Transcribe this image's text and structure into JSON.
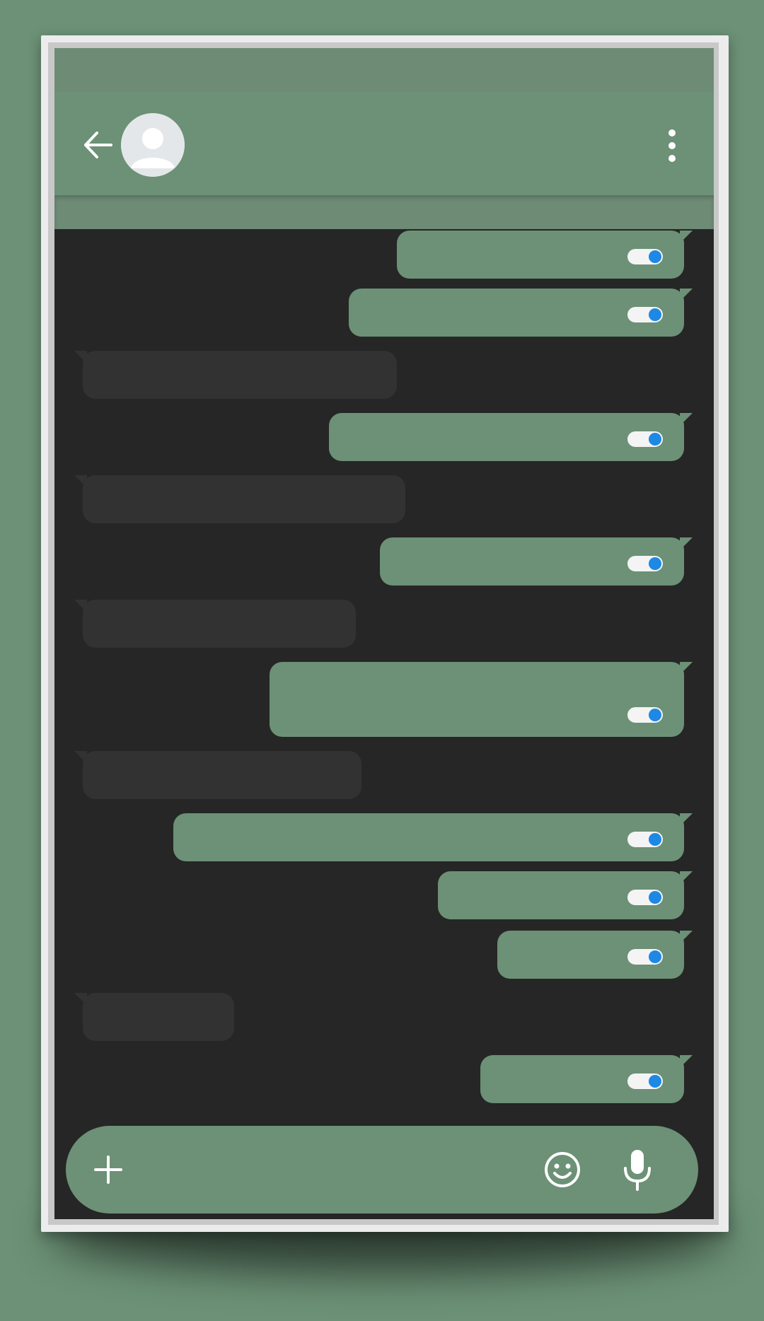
{
  "colors": {
    "accent": "#6c9176",
    "status_bar": "#6e8b76",
    "chat_bg": "#262626",
    "incoming_bubble": "#323232",
    "toggle_knob": "#1e88e5",
    "toggle_track": "#f4f4f4"
  },
  "header": {
    "back_icon": "arrow-left-icon",
    "avatar_icon": "person-avatar-icon",
    "menu_icon": "more-vertical-icon"
  },
  "messages": [
    {
      "direction": "out",
      "text": "",
      "read_toggle": "on"
    },
    {
      "direction": "out",
      "text": "",
      "read_toggle": "on"
    },
    {
      "direction": "in",
      "text": ""
    },
    {
      "direction": "out",
      "text": "",
      "read_toggle": "on"
    },
    {
      "direction": "in",
      "text": ""
    },
    {
      "direction": "out",
      "text": "",
      "read_toggle": "on"
    },
    {
      "direction": "in",
      "text": ""
    },
    {
      "direction": "out",
      "text": "",
      "read_toggle": "on"
    },
    {
      "direction": "in",
      "text": ""
    },
    {
      "direction": "out",
      "text": "",
      "read_toggle": "on"
    },
    {
      "direction": "out",
      "text": "",
      "read_toggle": "on"
    },
    {
      "direction": "out",
      "text": "",
      "read_toggle": "on"
    },
    {
      "direction": "in",
      "text": ""
    },
    {
      "direction": "out",
      "text": "",
      "read_toggle": "on"
    }
  ],
  "composer": {
    "add_icon": "plus-icon",
    "emoji_icon": "emoji-icon",
    "mic_icon": "microphone-icon",
    "input_value": ""
  }
}
